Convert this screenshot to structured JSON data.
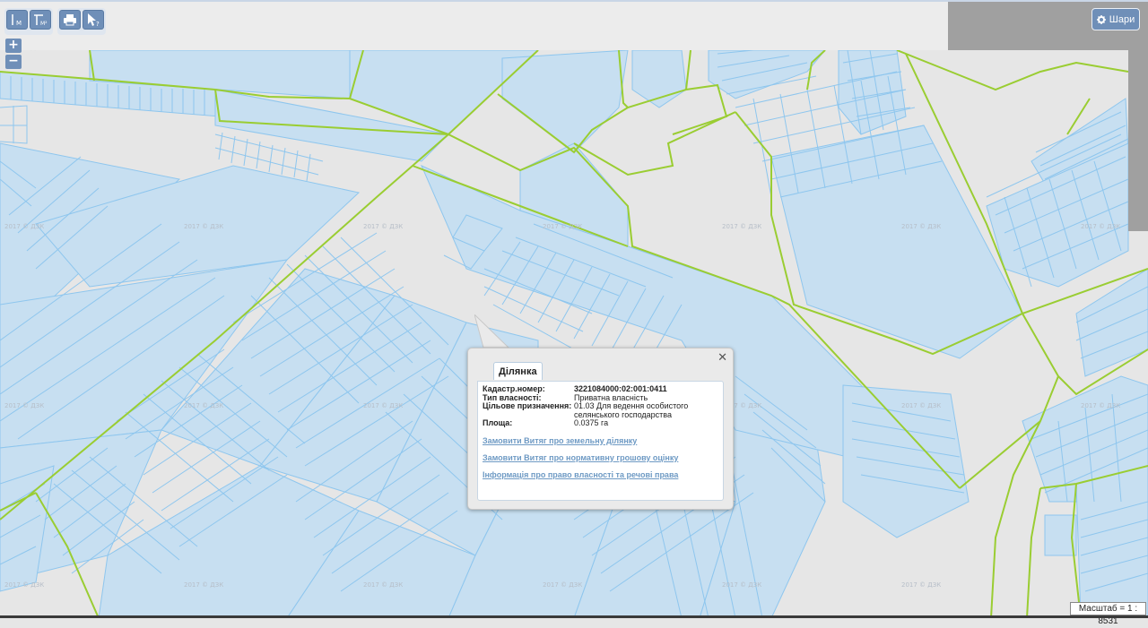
{
  "toolbar": {
    "tools": [
      {
        "name": "measure-length",
        "icon": "ruler-m-icon",
        "label": "М"
      },
      {
        "name": "measure-area",
        "icon": "ruler-m2-icon",
        "label": "М²"
      },
      {
        "name": "print",
        "icon": "printer-icon",
        "label": ""
      },
      {
        "name": "identify",
        "icon": "cursor-help-icon",
        "label": "?"
      }
    ],
    "zoom_in": "+",
    "zoom_out": "−",
    "layers_label": "Шари",
    "layers_icon": "gear-icon"
  },
  "popup": {
    "tab_label": "Ділянка",
    "close_symbol": "✕",
    "properties": [
      {
        "label": "Кадастр.номер:",
        "value": "3221084000:02:001:0411",
        "strong": true
      },
      {
        "label": "Тип власності:",
        "value": "Приватна власність",
        "strong": false
      },
      {
        "label": "Цільове призначення:",
        "value": "01.03 Для ведення особистого селянського господарства",
        "strong": false
      },
      {
        "label": "Площа:",
        "value": "0.0375 га",
        "strong": false
      }
    ],
    "links": [
      "Замовити Витяг про земельну ділянку",
      "Замовити Витяг про нормативну грошову оцінку",
      "Інформація про право власності та речові права"
    ]
  },
  "scale_label": "Масштаб = 1 : 8531",
  "watermark_text": "2017 © ДЗК",
  "colors": {
    "background": "#e6e6e6",
    "parcel_fill": "#c7dff1",
    "parcel_stroke": "#8ec6ee",
    "boundary_green": "#9acd32",
    "tool_button": "#6f8fb8",
    "link": "#6e9ac4"
  }
}
